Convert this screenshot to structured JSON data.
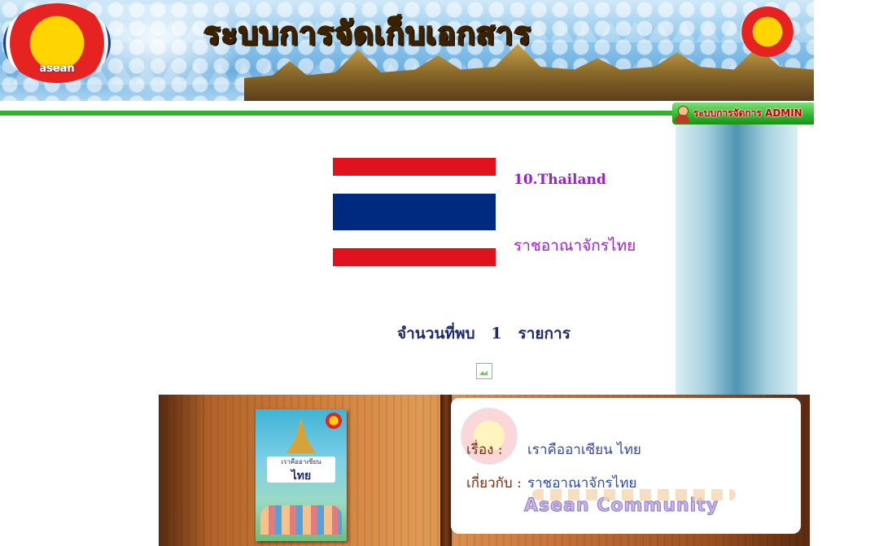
{
  "header": {
    "title": "ระบบการจัดเก็บเอกสาร",
    "logo_text": "asean",
    "admin_label": "ระบบการจัดการ ADMIN"
  },
  "country": {
    "name": "10.Thailand",
    "thai_name": "ราชอาณาจักรไทย",
    "flag_colors": [
      "#e0121d",
      "#ffffff",
      "#002a80",
      "#ffffff",
      "#e0121d"
    ]
  },
  "results": {
    "label": "จำนวนที่พบ",
    "count": "1",
    "unit": "รายการ"
  },
  "record": {
    "subject_label": "เรื่อง :",
    "subject_value": "เราคืออาเซียน ไทย",
    "about_label": "เกี่ยวกับ :",
    "about_value": "ราชอาณาจักรไทย",
    "book_title": "เราคืออาเซียน",
    "book_title_big": "ไทย",
    "community_text": "Asean Community"
  },
  "colors": {
    "accent_green": "#2fb52a",
    "country_text": "#9b1fcf",
    "result_text": "#1a2a6c"
  }
}
